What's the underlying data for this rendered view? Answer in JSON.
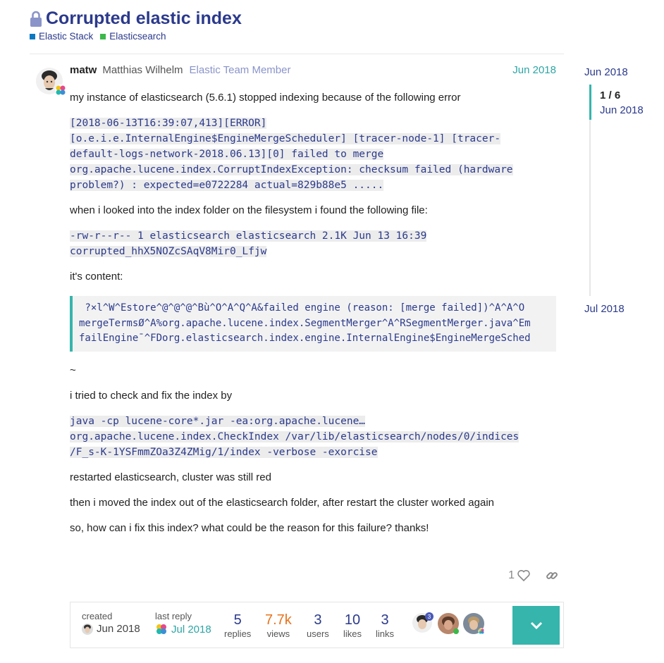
{
  "topic": {
    "title": "Corrupted elastic index",
    "tags": [
      {
        "label": "Elastic Stack",
        "color": "#0b78c2"
      },
      {
        "label": "Elasticsearch",
        "color": "#3cb84a"
      }
    ]
  },
  "post": {
    "username": "matw",
    "full_name": "Matthias Wilhelm",
    "user_title": "Elastic Team Member",
    "date": "Jun 2018",
    "p1": "my instance of elasticsearch (5.6.1) stopped indexing because of the following error",
    "code1": [
      "[2018-06-13T16:39:07,413][ERROR]",
      "[o.e.i.e.InternalEngine$EngineMergeScheduler] [tracer-node-1] [tracer-",
      "default-logs-network-2018.06.13][0] failed to merge",
      "org.apache.lucene.index.CorruptIndexException: checksum failed (hardware",
      "problem?) : expected=e0722284 actual=829b88e5 ....."
    ],
    "p2": "when i looked into the index folder on the filesystem i found the following file:",
    "code2": [
      "-rw-r--r-- 1 elasticsearch elasticsearch 2.1K Jun 13 16:39",
      "corrupted_hhX5NOZcSAqV8Mir0_Lfjw"
    ],
    "p3": "it's content:",
    "pre_lines": [
      " ?×l^W^Estore^@^@^@^Bù^O^A^Q^A&failed engine (reason: [merge failed])^A^A^O",
      "mergeTermsØ^A%org.apache.lucene.index.SegmentMerger^A^RSegmentMerger.java^Em",
      "failEngine¯^FDorg.elasticsearch.index.engine.InternalEngine$EngineMergeSched"
    ],
    "tilde": "~",
    "p4": "i tried to check and fix the index by",
    "code3": [
      "java -cp lucene-core*.jar -ea:org.apache.lucene…",
      "org.apache.lucene.index.CheckIndex /var/lib/elasticsearch/nodes/0/indices",
      "/F_s-K-1YSFmmZOa3Z4ZMig/1/index -verbose -exorcise"
    ],
    "p5": "restarted elasticsearch, cluster was still red",
    "p6": "then i moved the index out of the elasticsearch folder, after restart the cluster worked again",
    "p7": "so, how can i fix this index? what could be the reason for this failure? thanks!",
    "like_count": "1"
  },
  "topic_map": {
    "created_label": "created",
    "created_date": "Jun 2018",
    "last_reply_label": "last reply",
    "last_reply_date": "Jul 2018",
    "stats": [
      {
        "num": "5",
        "label": "replies",
        "color": "#2b3a8c"
      },
      {
        "num": "7.7k",
        "label": "views",
        "color": "#e8731c"
      },
      {
        "num": "3",
        "label": "users",
        "color": "#2b3a8c"
      },
      {
        "num": "10",
        "label": "likes",
        "color": "#2b3a8c"
      },
      {
        "num": "3",
        "label": "links",
        "color": "#2b3a8c"
      }
    ],
    "participant_badge": "3"
  },
  "timeline": {
    "start_date": "Jun 2018",
    "count": "1 / 6",
    "current_date": "Jun 2018",
    "end_date": "Jul 2018"
  }
}
